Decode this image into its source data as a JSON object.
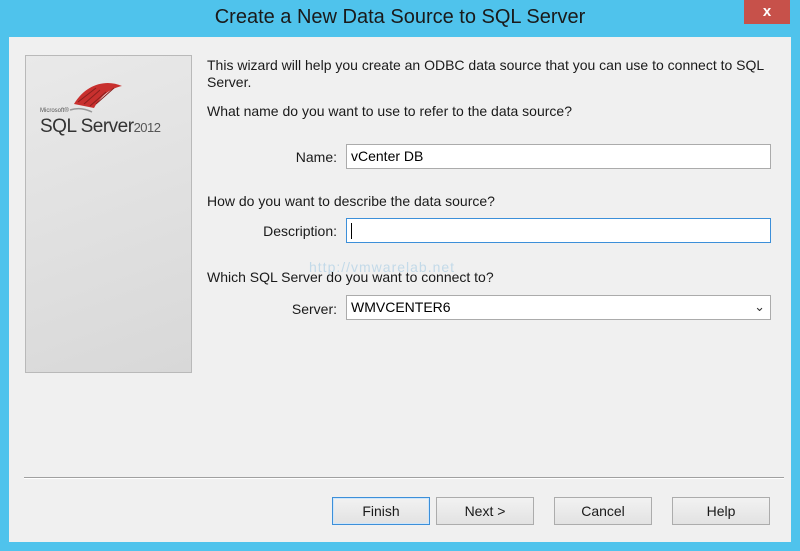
{
  "window": {
    "title": "Create a New Data Source to SQL Server",
    "close_label": "x"
  },
  "side": {
    "microsoft": "Microsoft®",
    "product": "SQL Server",
    "year": "2012"
  },
  "intro": "This wizard will help you create an ODBC data source that you can use to connect to SQL Server.",
  "name_question": "What name do you want to use to refer to the data source?",
  "name_label": "Name:",
  "name_value": "vCenter DB",
  "desc_question": "How do you want to describe the data source?",
  "desc_label": "Description:",
  "desc_value": "",
  "server_question": "Which SQL Server do you want to connect to?",
  "server_label": "Server:",
  "server_value": "WMVCENTER6",
  "watermark": "http://vmwarelab.net",
  "buttons": {
    "finish": "Finish",
    "next": "Next >",
    "cancel": "Cancel",
    "help": "Help"
  }
}
